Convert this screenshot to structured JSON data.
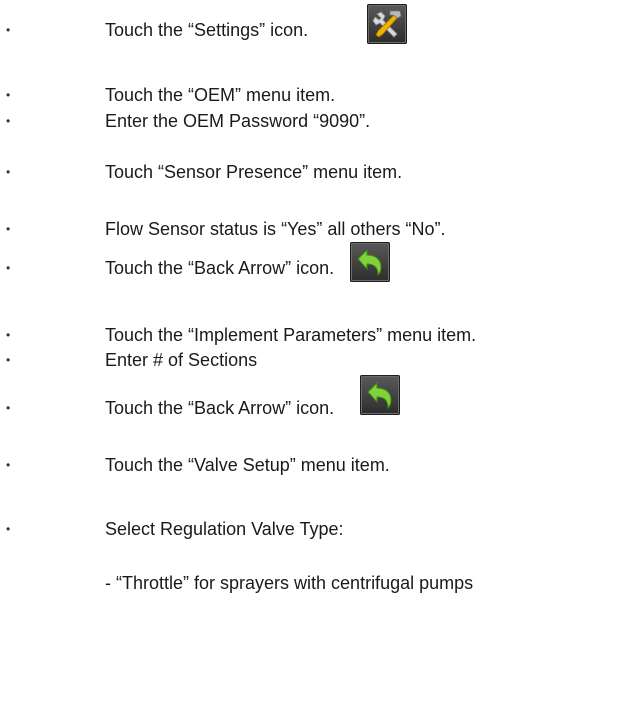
{
  "steps": [
    {
      "bullet": "•",
      "text": "Touch the “Settings” icon."
    },
    {
      "bullet": "•",
      "text": "Touch the “OEM” menu item."
    },
    {
      "bullet": "•",
      "text": "Enter the OEM Password “9090”."
    },
    {
      "bullet": "•",
      "text": "Touch “Sensor Presence” menu item."
    },
    {
      "bullet": "•",
      "text": "Flow Sensor status is “Yes” all others “No”."
    },
    {
      "bullet": "•",
      "text": "Touch the “Back Arrow” icon."
    },
    {
      "bullet": "•",
      "text": "Touch the “Implement Parameters” menu item."
    },
    {
      "bullet": "•",
      "text": "Enter # of Sections"
    },
    {
      "bullet": "•",
      "text": "Touch the “Back Arrow” icon."
    },
    {
      "bullet": "•",
      "text": "Touch the “Valve Setup” menu item."
    },
    {
      "bullet": "•",
      "text": "Select Regulation Valve Type:"
    }
  ],
  "sub_item": "- “Throttle” for sprayers with centrifugal pumps",
  "icons": {
    "settings": "settings-tools-icon",
    "back": "back-arrow-icon"
  },
  "colors": {
    "icon_bg": "#3d3d3d",
    "arrow_green": "#7fd23a"
  }
}
